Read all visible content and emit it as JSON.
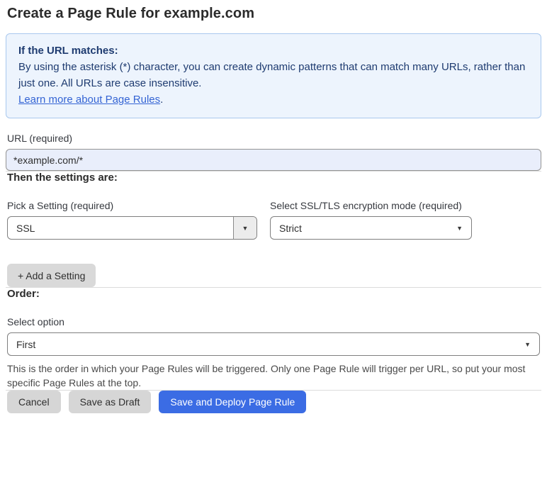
{
  "page": {
    "title": "Create a Page Rule for example.com"
  },
  "info_box": {
    "heading": "If the URL matches:",
    "body": "By using the asterisk (*) character, you can create dynamic patterns that can match many URLs, rather than just one. All URLs are case insensitive.",
    "link_label": "Learn more about Page Rules",
    "link_suffix": "."
  },
  "url_field": {
    "label": "URL (required)",
    "value": "*example.com/*"
  },
  "settings_section": {
    "heading": "Then the settings are:",
    "setting_select": {
      "label": "Pick a Setting (required)",
      "value": "SSL"
    },
    "mode_select": {
      "label": "Select SSL/TLS encryption mode (required)",
      "value": "Strict"
    },
    "add_button_label": "+ Add a Setting"
  },
  "order_section": {
    "heading": "Order:",
    "select_label": "Select option",
    "select_value": "First",
    "help_text": "This is the order in which your Page Rules will be triggered. Only one Page Rule will trigger per URL, so put your most specific Page Rules at the top."
  },
  "actions": {
    "cancel_label": "Cancel",
    "save_draft_label": "Save as Draft",
    "save_deploy_label": "Save and Deploy Page Rule"
  },
  "icons": {
    "dropdown_arrow": "▼"
  },
  "colors": {
    "info_background": "#edf4fd",
    "info_border": "#a9c8ee",
    "info_text": "#1e3b70",
    "link_blue": "#3464d4",
    "input_background": "#e9eefb",
    "primary_button_blue": "#3b6ce4",
    "secondary_button_gray": "#d6d6d6"
  }
}
